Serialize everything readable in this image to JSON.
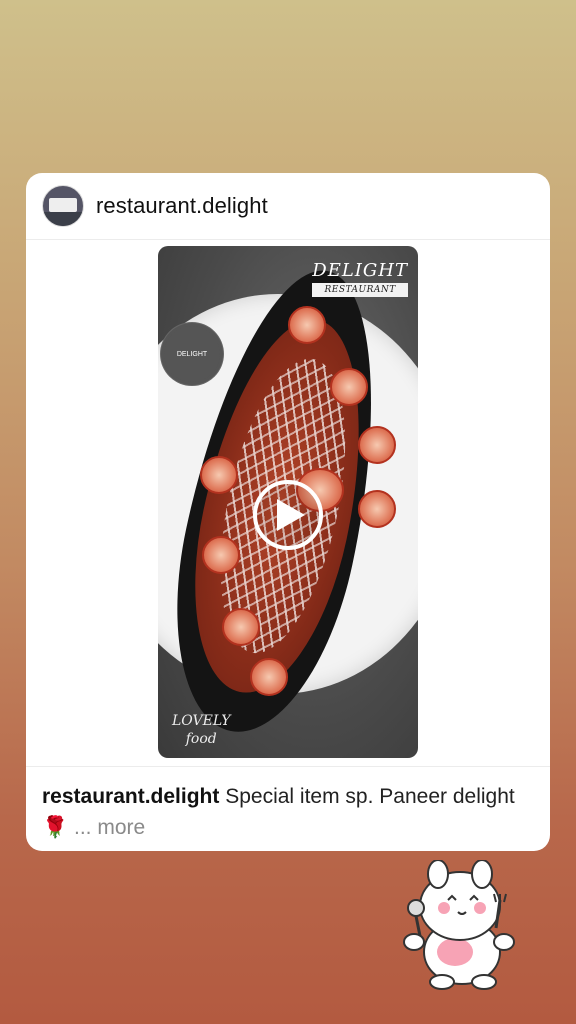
{
  "post": {
    "username": "restaurant.delight",
    "caption_username": "restaurant.delight",
    "caption_text": "Special item sp. Paneer delight",
    "caption_emoji": "🌹",
    "more_label": "... more"
  },
  "photo": {
    "brand_title": "DELIGHT",
    "brand_subtitle": "RESTAURANT",
    "badge_text": "DELIGHT",
    "overlay_line1": "LOVELY",
    "overlay_line2": "food"
  },
  "icons": {
    "play": "play-icon",
    "avatar": "avatar-image",
    "sticker": "bunny-sticker"
  },
  "colors": {
    "background_top": "#cfc08b",
    "background_bottom": "#b35a40",
    "card": "#ffffff",
    "more_text": "#8a8a8a"
  }
}
